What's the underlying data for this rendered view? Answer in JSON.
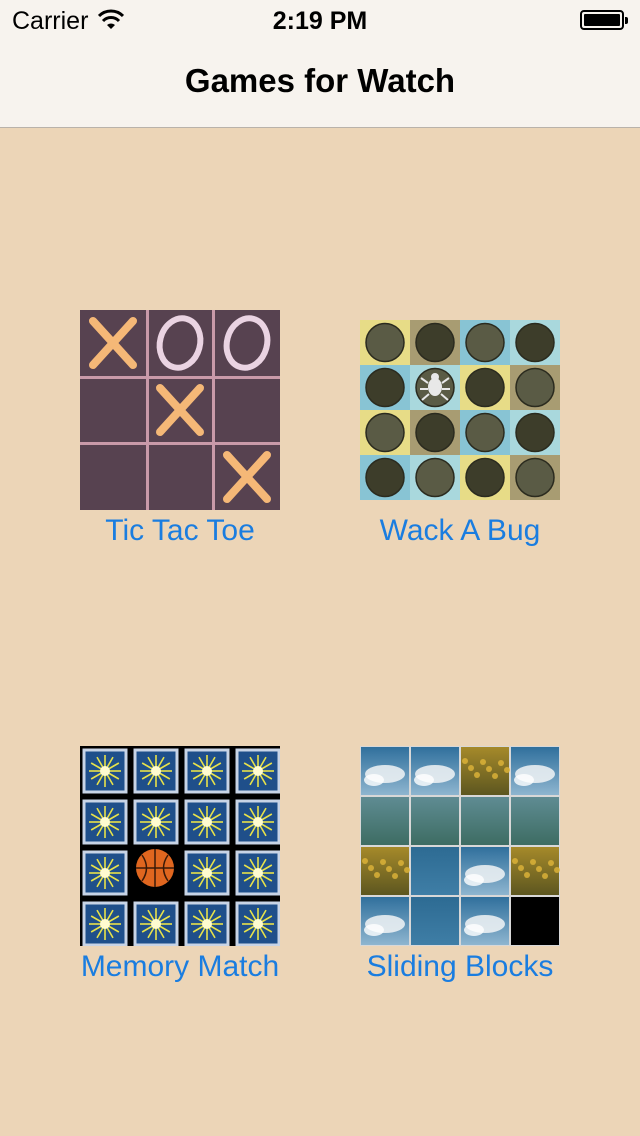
{
  "status_bar": {
    "carrier": "Carrier",
    "time": "2:19 PM"
  },
  "nav": {
    "title": "Games for Watch"
  },
  "games": [
    {
      "label": "Tic Tac Toe",
      "board": [
        "X",
        "O",
        "O",
        "",
        "X",
        "",
        "",
        "",
        "X"
      ]
    },
    {
      "label": "Wack A Bug"
    },
    {
      "label": "Memory Match"
    },
    {
      "label": "Sliding Blocks"
    }
  ],
  "colors": {
    "background": "#ecd5b7",
    "link": "#1a7de0",
    "bar": "#f7f3ee",
    "ttt_board": "#574250",
    "ttt_x": "#f5b877",
    "ttt_o": "#ead3e2"
  }
}
